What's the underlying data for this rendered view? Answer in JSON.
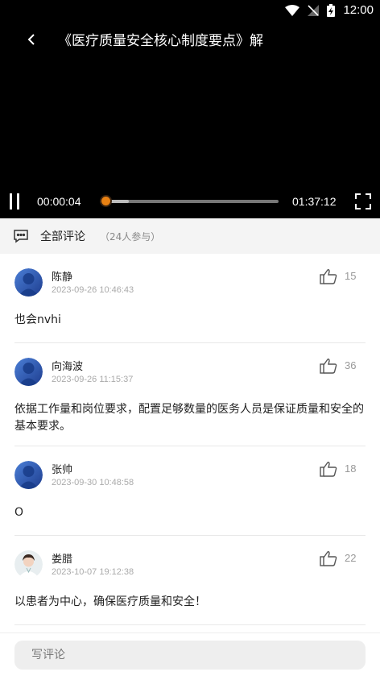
{
  "status_bar": {
    "time": "12:00",
    "icons": [
      "wifi-icon",
      "no-signal-icon",
      "battery-charging-icon"
    ]
  },
  "video": {
    "title": "《医疗质量安全核心制度要点》解",
    "current_time": "00:00:04",
    "total_time": "01:37:12",
    "progress_fraction": 0.0007,
    "buffered_fraction": 0.16,
    "accent_color": "#e88113"
  },
  "comments_section": {
    "title": "全部评论",
    "participants": "（24人参与）"
  },
  "comments": [
    {
      "name": "陈静",
      "time": "2023-09-26 10:46:43",
      "likes": "15",
      "text": "也会nvhi"
    },
    {
      "name": "向海波",
      "time": "2023-09-26 11:15:37",
      "likes": "36",
      "text": "依据工作量和岗位要求，配置足够数量的医务人员是保证质量和安全的基本要求。"
    },
    {
      "name": "张帅",
      "time": "2023-09-30 10:48:58",
      "likes": "18",
      "text": "O"
    },
    {
      "name": "娄腊",
      "time": "2023-10-07 19:12:38",
      "likes": "22",
      "text": "以患者为中心，确保医疗质量和安全！"
    }
  ],
  "input": {
    "placeholder": "写评论"
  }
}
